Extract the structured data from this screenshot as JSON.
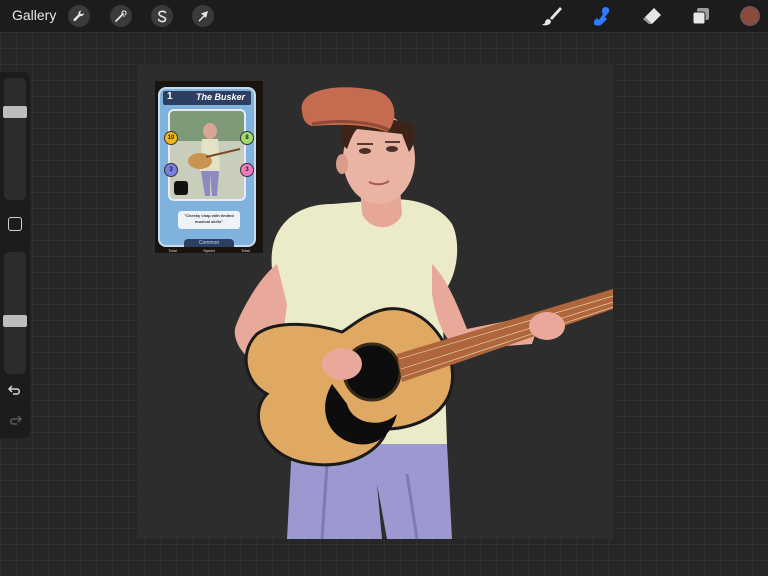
{
  "toolbar": {
    "gallery_label": "Gallery",
    "left_tools": [
      {
        "name": "wrench-icon"
      },
      {
        "name": "magic-wand-icon"
      },
      {
        "name": "selection-s-icon"
      },
      {
        "name": "transform-arrow-icon"
      }
    ],
    "right_tools": [
      {
        "name": "brush-icon",
        "active": false
      },
      {
        "name": "smudge-icon",
        "active": true
      },
      {
        "name": "eraser-icon",
        "active": false
      },
      {
        "name": "layers-icon",
        "active": false
      }
    ],
    "current_color": "#8b4a3e",
    "active_tool_color": "#2f7bff"
  },
  "sidebar": {
    "brush_size": 0.75,
    "opacity": 0.43
  },
  "card": {
    "number": "1",
    "title": "The Busker",
    "stats": [
      "10",
      "8",
      "3",
      "3"
    ],
    "quote": "\"Cheeky chap with limited musical skills\"",
    "rarity": "Common",
    "footer": [
      "Total",
      "Speed",
      "Total"
    ]
  }
}
